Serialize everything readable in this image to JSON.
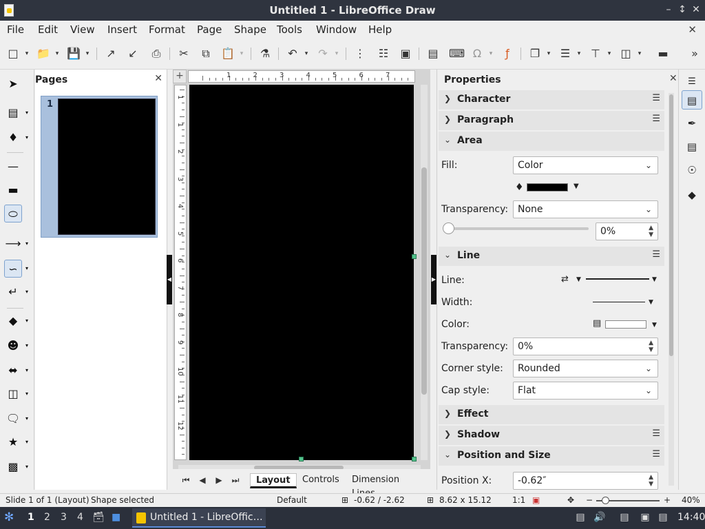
{
  "window": {
    "title": "Untitled 1 - LibreOffice Draw"
  },
  "menu": [
    "File",
    "Edit",
    "View",
    "Insert",
    "Format",
    "Page",
    "Shape",
    "Tools",
    "Window",
    "Help"
  ],
  "pages_pane": {
    "title": "Pages",
    "page_number": "1"
  },
  "ruler": {
    "h_numbers": [
      "1",
      "2",
      "3",
      "4",
      "5",
      "6",
      "7"
    ],
    "v_numbers": [
      "1",
      "1",
      "2",
      "3",
      "4",
      "5",
      "6",
      "7",
      "8",
      "9",
      "10",
      "11",
      "12"
    ]
  },
  "tabs": {
    "layout": "Layout",
    "controls": "Controls",
    "dimension_lines": "Dimension Lines"
  },
  "properties": {
    "title": "Properties",
    "sections": {
      "character": "Character",
      "paragraph": "Paragraph",
      "area": "Area",
      "line": "Line",
      "effect": "Effect",
      "shadow": "Shadow",
      "position_size": "Position and Size"
    },
    "area": {
      "fill_label": "Fill:",
      "fill_value": "Color",
      "fill_color": "#000000",
      "transparency_label": "Transparency:",
      "transparency_value": "None",
      "transparency_percent": "0%",
      "slider_value": 0
    },
    "line": {
      "line_label": "Line:",
      "width_label": "Width:",
      "color_label": "Color:",
      "color_value": "#ffffff",
      "transparency_label": "Transparency:",
      "transparency_value": "0%",
      "corner_label": "Corner style:",
      "corner_value": "Rounded",
      "cap_label": "Cap style:",
      "cap_value": "Flat"
    },
    "position": {
      "x_label": "Position X:",
      "x_value": "-0.62″"
    }
  },
  "status": {
    "slide": "Slide 1 of 1 (Layout)",
    "selection": "Shape selected",
    "master": "Default",
    "position": "-0.62 / -2.62",
    "size": "8.62 x 15.12",
    "scale": "1:1",
    "zoom": "40%"
  },
  "taskbar": {
    "workspaces": [
      "1",
      "2",
      "3",
      "4"
    ],
    "window_button": "Untitled 1 - LibreOffic…",
    "clock": "14:40"
  }
}
